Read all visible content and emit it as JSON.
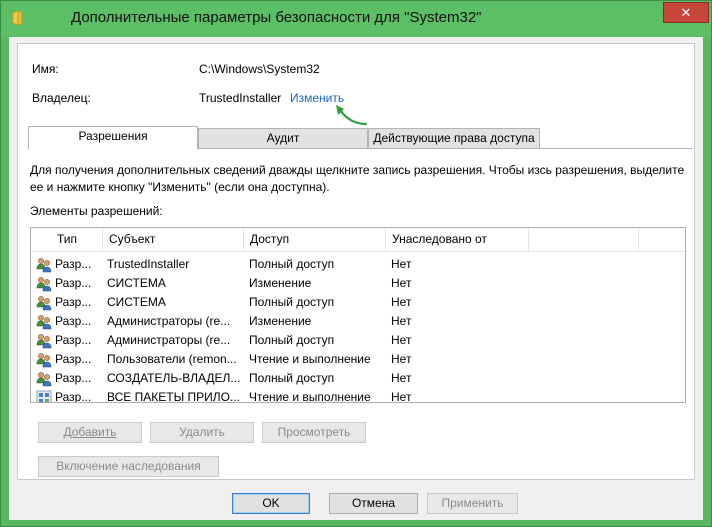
{
  "window": {
    "title": "Дополнительные параметры безопасности  для \"System32\"",
    "close_symbol": "✕"
  },
  "object": {
    "name_label": "Имя:",
    "name_value": "C:\\Windows\\System32",
    "owner_label": "Владелец:",
    "owner_value": "TrustedInstaller",
    "change_owner_link": "Изменить"
  },
  "tabs": [
    {
      "label": "Разрешения",
      "active": true
    },
    {
      "label": "Аудит",
      "active": false
    },
    {
      "label": "Действующие права доступа",
      "active": false
    }
  ],
  "permissions": {
    "description": "Для получения дополнительных сведений дважды щелкните запись разрешения. Чтобы изсь разрешения, выделите ее и нажмите кнопку \"Изменить\" (если она доступна).",
    "entries_label": "Элементы разрешений:",
    "columns": [
      "Тип",
      "Субъект",
      "Доступ",
      "Унаследовано от"
    ],
    "rows": [
      {
        "icon": "users-icon",
        "type": "Разр...",
        "principal": "TrustedInstaller",
        "access": "Полный доступ",
        "inherited": "Нет"
      },
      {
        "icon": "users-icon",
        "type": "Разр...",
        "principal": "СИСТЕМА",
        "access": "Изменение",
        "inherited": "Нет"
      },
      {
        "icon": "users-icon",
        "type": "Разр...",
        "principal": "СИСТЕМА",
        "access": "Полный доступ",
        "inherited": "Нет"
      },
      {
        "icon": "users-icon",
        "type": "Разр...",
        "principal": "Администраторы (re...",
        "access": "Изменение",
        "inherited": "Нет"
      },
      {
        "icon": "users-icon",
        "type": "Разр...",
        "principal": "Администраторы (re...",
        "access": "Полный доступ",
        "inherited": "Нет"
      },
      {
        "icon": "users-icon",
        "type": "Разр...",
        "principal": "Пользователи (remon...",
        "access": "Чтение и выполнение",
        "inherited": "Нет"
      },
      {
        "icon": "users-icon",
        "type": "Разр...",
        "principal": "СОЗДАТЕЛЬ-ВЛАДЕЛ...",
        "access": "Полный доступ",
        "inherited": "Нет"
      },
      {
        "icon": "app-packages-icon",
        "type": "Разр...",
        "principal": "ВСЕ ПАКЕТЫ ПРИЛО...",
        "access": "Чтение и выполнение",
        "inherited": "Нет"
      }
    ],
    "buttons": {
      "add": "Добавить",
      "remove": "Удалить",
      "view": "Просмотреть",
      "enable_inheritance": "Включение наследования"
    }
  },
  "footer": {
    "ok": "OK",
    "cancel": "Отмена",
    "apply": "Применить"
  },
  "colors": {
    "titlebar": "#5cbf66",
    "link": "#1a66c6",
    "arrow": "#2e9e3a"
  }
}
